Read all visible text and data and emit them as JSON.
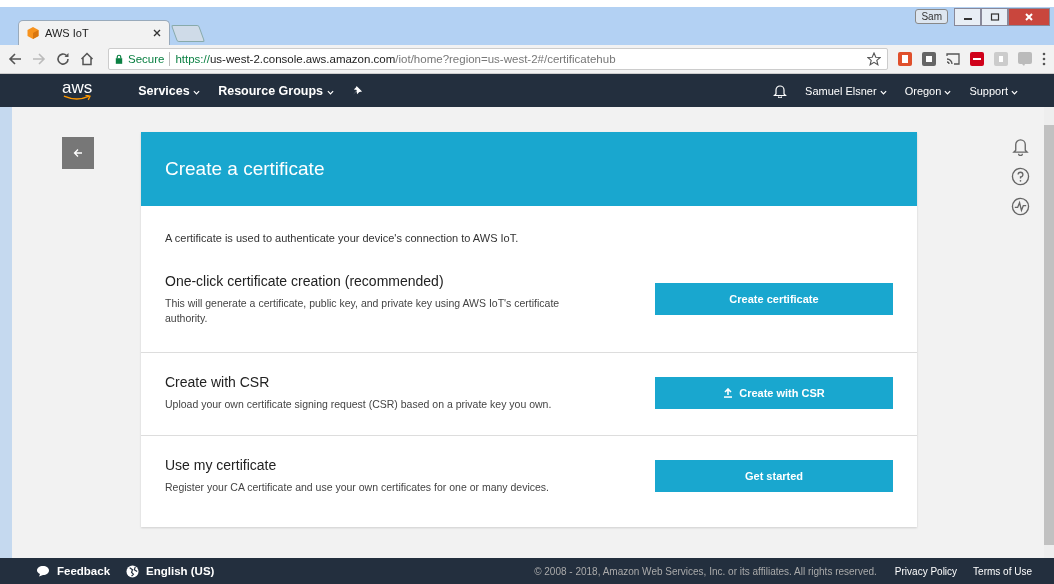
{
  "browser": {
    "tab_title": "AWS IoT",
    "profile": "Sam",
    "secure_label": "Secure",
    "url_scheme": "https://",
    "url_host": "us-west-2.console.aws.amazon.com",
    "url_path": "/iot/home?region=us-west-2#/certificatehub"
  },
  "navbar": {
    "logo": "aws",
    "menus": [
      {
        "label": "Services"
      },
      {
        "label": "Resource Groups"
      }
    ],
    "user": "Samuel Elsner",
    "region": "Oregon",
    "support": "Support"
  },
  "card": {
    "title": "Create a certificate",
    "intro": "A certificate is used to authenticate your device's connection to AWS IoT.",
    "sections": [
      {
        "heading": "One-click certificate creation (recommended)",
        "description": "This will generate a certificate, public key, and private key using AWS IoT's certificate authority.",
        "button": "Create certificate",
        "upload_icon": false
      },
      {
        "heading": "Create with CSR",
        "description": "Upload your own certificate signing request (CSR) based on a private key you own.",
        "button": "Create with CSR",
        "upload_icon": true
      },
      {
        "heading": "Use my certificate",
        "description": "Register your CA certificate and use your own certificates for one or many devices.",
        "button": "Get started",
        "upload_icon": false
      }
    ]
  },
  "footer": {
    "feedback": "Feedback",
    "language": "English (US)",
    "copyright": "© 2008 - 2018, Amazon Web Services, Inc. or its affiliates. All rights reserved.",
    "links": [
      "Privacy Policy",
      "Terms of Use"
    ]
  }
}
